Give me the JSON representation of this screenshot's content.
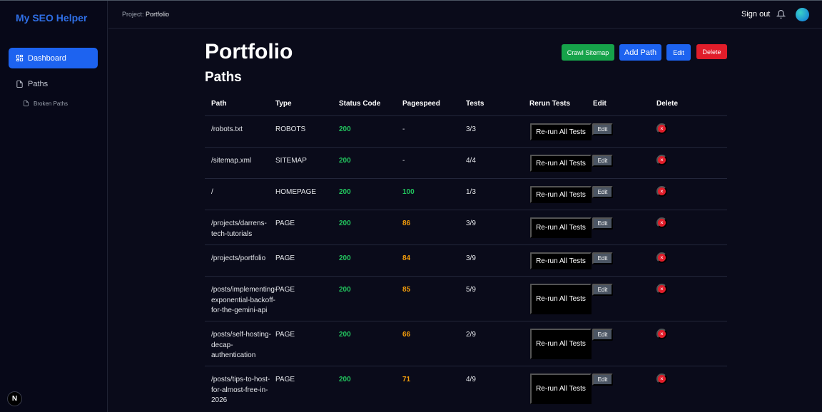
{
  "app": {
    "title": "My SEO Helper"
  },
  "sidebar": {
    "items": [
      {
        "label": "Dashboard",
        "icon": "dashboard-grid-icon"
      },
      {
        "label": "Paths",
        "icon": "file-icon"
      },
      {
        "label": "Broken Paths",
        "icon": "file-icon"
      }
    ],
    "badge": "N"
  },
  "topbar": {
    "crumb_label": "Project:",
    "crumb_value": "Portfolio",
    "signout": "Sign out"
  },
  "page": {
    "title": "Portfolio",
    "section": "Paths",
    "buttons": {
      "crawl": "Crawl Sitemap",
      "add": "Add Path",
      "edit": "Edit",
      "delete": "Delete"
    }
  },
  "table": {
    "headers": [
      "Path",
      "Type",
      "Status Code",
      "Pagespeed",
      "Tests",
      "Rerun Tests",
      "Edit",
      "Delete"
    ],
    "rerun_label": "Re-run All Tests",
    "edit_label": "Edit",
    "delete_label": "×",
    "rows": [
      {
        "path": "/robots.txt",
        "type": "ROBOTS",
        "status": "200",
        "pagespeed": "-",
        "tests": "3/3"
      },
      {
        "path": "/sitemap.xml",
        "type": "SITEMAP",
        "status": "200",
        "pagespeed": "-",
        "tests": "4/4"
      },
      {
        "path": "/",
        "type": "HOMEPAGE",
        "status": "200",
        "pagespeed": "100",
        "tests": "1/3"
      },
      {
        "path": "/projects/darrens-tech-tutorials",
        "type": "PAGE",
        "status": "200",
        "pagespeed": "86",
        "tests": "3/9"
      },
      {
        "path": "/projects/portfolio",
        "type": "PAGE",
        "status": "200",
        "pagespeed": "84",
        "tests": "3/9"
      },
      {
        "path": "/posts/implementing-exponential-backoff-for-the-gemini-api",
        "type": "PAGE",
        "status": "200",
        "pagespeed": "85",
        "tests": "5/9"
      },
      {
        "path": "/posts/self-hosting-decap-authentication",
        "type": "PAGE",
        "status": "200",
        "pagespeed": "66",
        "tests": "2/9"
      },
      {
        "path": "/posts/tips-to-host-for-almost-free-in-2026",
        "type": "PAGE",
        "status": "200",
        "pagespeed": "71",
        "tests": "4/9"
      }
    ]
  },
  "colors": {
    "status_ok": "#22c55e",
    "speed_good": "#22c55e",
    "speed_mid": "#f59e0b",
    "neutral": "#e5e7eb"
  }
}
